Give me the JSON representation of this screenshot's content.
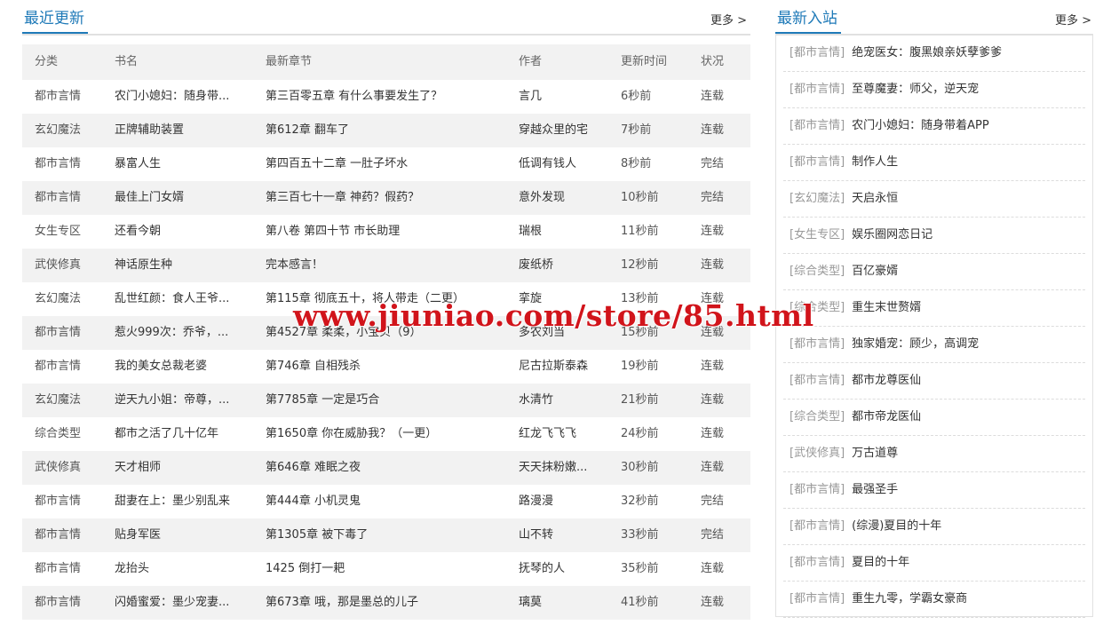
{
  "recent": {
    "title": "最近更新",
    "more": "更多 >",
    "headers": [
      "分类",
      "书名",
      "最新章节",
      "作者",
      "更新时间",
      "状况"
    ],
    "rows": [
      {
        "cat": "都市言情",
        "book": "农门小媳妇：随身带...",
        "chapter": "第三百零五章 有什么事要发生了？",
        "author": "言几",
        "time": "6秒前",
        "status": "连载"
      },
      {
        "cat": "玄幻魔法",
        "book": "正牌辅助装置",
        "chapter": "第612章 翻车了",
        "author": "穿越众里的宅",
        "time": "7秒前",
        "status": "连载"
      },
      {
        "cat": "都市言情",
        "book": "暴富人生",
        "chapter": "第四百五十二章 一肚子坏水",
        "author": "低调有钱人",
        "time": "8秒前",
        "status": "完结"
      },
      {
        "cat": "都市言情",
        "book": "最佳上门女婿",
        "chapter": "第三百七十一章 神药？假药？",
        "author": "意外发现",
        "time": "10秒前",
        "status": "完结"
      },
      {
        "cat": "女生专区",
        "book": "还看今朝",
        "chapter": "第八卷 第四十节 市长助理",
        "author": "瑞根",
        "time": "11秒前",
        "status": "连载"
      },
      {
        "cat": "武侠修真",
        "book": "神话原生种",
        "chapter": "完本感言！",
        "author": "废纸桥",
        "time": "12秒前",
        "status": "连载"
      },
      {
        "cat": "玄幻魔法",
        "book": "乱世红颜：食人王爷...",
        "chapter": "第115章 彻底五十，将人带走（二更）",
        "author": "挛旋",
        "time": "13秒前",
        "status": "连载"
      },
      {
        "cat": "都市言情",
        "book": "惹火999次：乔爷，...",
        "chapter": "第4527章 柔柔，小宝贝（9）",
        "author": "多农刘当",
        "time": "15秒前",
        "status": "连载"
      },
      {
        "cat": "都市言情",
        "book": "我的美女总裁老婆",
        "chapter": "第746章 自相残杀",
        "author": "尼古拉斯泰森",
        "time": "19秒前",
        "status": "连载"
      },
      {
        "cat": "玄幻魔法",
        "book": "逆天九小姐：帝尊，...",
        "chapter": "第7785章 一定是巧合",
        "author": "水清竹",
        "time": "21秒前",
        "status": "连载"
      },
      {
        "cat": "综合类型",
        "book": "都市之活了几十亿年",
        "chapter": "第1650章 你在威胁我？（一更）",
        "author": "红龙飞飞飞",
        "time": "24秒前",
        "status": "连载"
      },
      {
        "cat": "武侠修真",
        "book": "天才相师",
        "chapter": "第646章 难眠之夜",
        "author": "天天抹粉嫩...",
        "time": "30秒前",
        "status": "连载"
      },
      {
        "cat": "都市言情",
        "book": "甜妻在上：墨少别乱来",
        "chapter": "第444章 小机灵鬼",
        "author": "路漫漫",
        "time": "32秒前",
        "status": "完结"
      },
      {
        "cat": "都市言情",
        "book": "贴身军医",
        "chapter": "第1305章 被下毒了",
        "author": "山不转",
        "time": "33秒前",
        "status": "完结"
      },
      {
        "cat": "都市言情",
        "book": "龙抬头",
        "chapter": "1425 倒打一耙",
        "author": "抚琴的人",
        "time": "35秒前",
        "status": "连载"
      },
      {
        "cat": "都市言情",
        "book": "闪婚蜜爱：墨少宠妻...",
        "chapter": "第673章 哦，那是墨总的儿子",
        "author": "璃莫",
        "time": "41秒前",
        "status": "连载"
      }
    ]
  },
  "newest": {
    "title": "最新入站",
    "more": "更多 >",
    "items": [
      {
        "cat": "[都市言情]",
        "name": "绝宠医女：腹黑娘亲妖孽爹爹"
      },
      {
        "cat": "[都市言情]",
        "name": "至尊魔妻：师父，逆天宠"
      },
      {
        "cat": "[都市言情]",
        "name": "农门小媳妇：随身带着APP"
      },
      {
        "cat": "[都市言情]",
        "name": "制作人生"
      },
      {
        "cat": "[玄幻魔法]",
        "name": "天启永恒"
      },
      {
        "cat": "[女生专区]",
        "name": "娱乐圈网恋日记"
      },
      {
        "cat": "[综合类型]",
        "name": "百亿豪婿"
      },
      {
        "cat": "[综合类型]",
        "name": "重生末世赘婿"
      },
      {
        "cat": "[都市言情]",
        "name": "独家婚宠：顾少，高调宠"
      },
      {
        "cat": "[都市言情]",
        "name": "都市龙尊医仙"
      },
      {
        "cat": "[综合类型]",
        "name": "都市帝龙医仙"
      },
      {
        "cat": "[武侠修真]",
        "name": "万古道尊"
      },
      {
        "cat": "[都市言情]",
        "name": "最强圣手"
      },
      {
        "cat": "[都市言情]",
        "name": "(综漫)夏目的十年"
      },
      {
        "cat": "[都市言情]",
        "name": "夏目的十年"
      },
      {
        "cat": "[都市言情]",
        "name": "重生九零，学霸女豪商"
      }
    ]
  },
  "watermark": "www.jiuniao.com/store/85.html"
}
